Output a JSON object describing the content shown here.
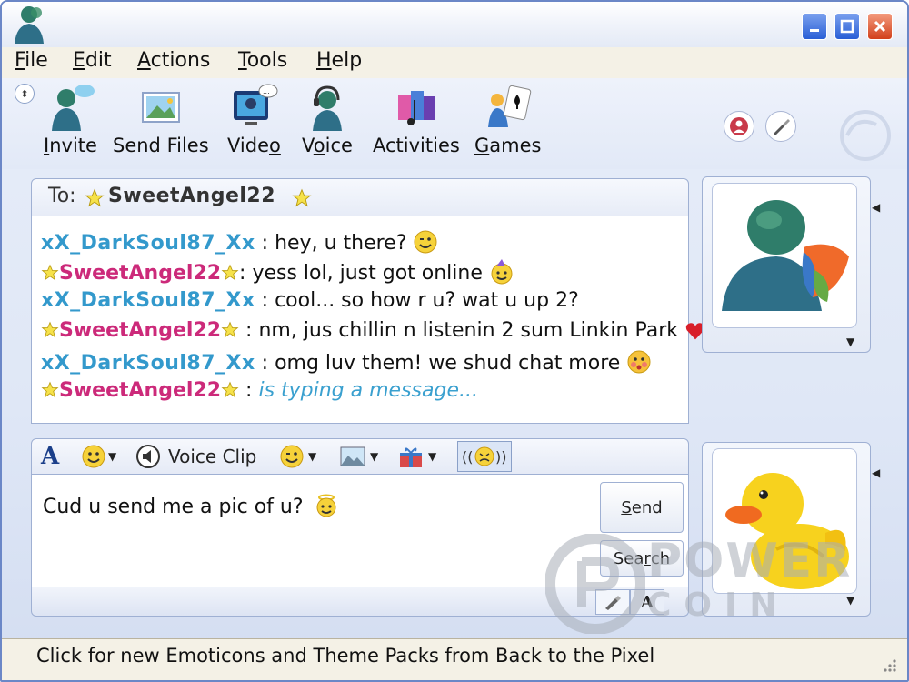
{
  "menu": {
    "file": {
      "key": "F",
      "rest": "ile"
    },
    "edit": {
      "key": "E",
      "rest": "dit"
    },
    "actions": {
      "key": "A",
      "rest": "ctions"
    },
    "tools": {
      "key": "T",
      "rest": "ools"
    },
    "help": {
      "key": "H",
      "rest": "elp"
    }
  },
  "toolbar": {
    "invite": {
      "key": "I",
      "rest": "nvite",
      "icon": "buddy-icon"
    },
    "send_files": {
      "label": "Send Files",
      "icon": "pictures-icon"
    },
    "video": {
      "key": "V",
      "mid": "ide",
      "tail": "o",
      "icon": "webcam-icon"
    },
    "voice": {
      "pre": "V",
      "key": "o",
      "rest": "ice",
      "icon": "headset-icon"
    },
    "activities": {
      "label": "Activities",
      "icon": "music-icon"
    },
    "games": {
      "key": "G",
      "rest": "ames",
      "icon": "playing-cards-icon"
    }
  },
  "conversation": {
    "to_label": "To:",
    "contact_name": "SweetAngel22",
    "messages": [
      {
        "sender": "xX_DarkSoul87_Xx",
        "sep": " : ",
        "text": "hey, u there?",
        "emoticon": "wink"
      },
      {
        "sender": "SweetAngel22",
        "sep": ": ",
        "text": "yess lol, just got online",
        "emoticon": "party"
      },
      {
        "sender": "xX_DarkSoul87_Xx",
        "sep": " : ",
        "text": "cool... so how r u? wat u up 2?"
      },
      {
        "sender": "SweetAngel22",
        "sep": " : ",
        "text": "nm, jus chillin n listenin 2 sum Linkin Park",
        "emoticon": "heart"
      },
      {
        "sender": "xX_DarkSoul87_Xx",
        "sep": " : ",
        "text": "omg luv them! we shud chat more",
        "emoticon": "blush"
      },
      {
        "sender": "SweetAngel22",
        "sep": " : ",
        "typing": "is typing a message..."
      }
    ]
  },
  "format_bar": {
    "voice_clip": "Voice Clip"
  },
  "compose": {
    "text": "Cud u send me a pic of u?"
  },
  "buttons": {
    "send": {
      "key": "S",
      "rest": "end"
    },
    "search": {
      "pre": "Sea",
      "key": "r",
      "rest": "ch"
    }
  },
  "status": {
    "text": "Click for new Emoticons and Theme Packs from Back to the Pixel"
  },
  "watermark": {
    "line1": "POWER",
    "line2": "COIN"
  },
  "colors": {
    "dark_soul": "#3399cc",
    "sweet_angel": "#cc2a7a",
    "typing": "#3aa0cf"
  }
}
